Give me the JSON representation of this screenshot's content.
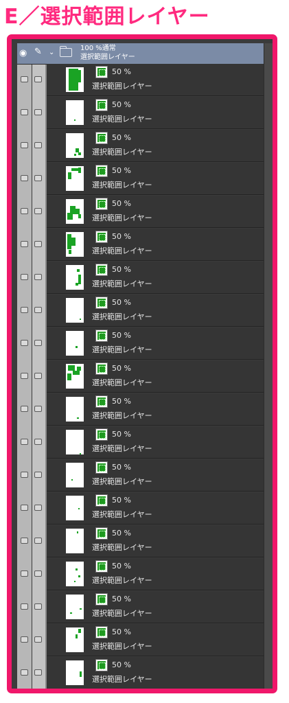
{
  "heading": "E／選択範囲レイヤー",
  "folder": {
    "opacity_blend": "100 %通常",
    "name": "選択範囲レイヤー"
  },
  "colors": {
    "frame": "#f0176a",
    "heading": "#ff2a7f",
    "folder_row": "#7b8ba6",
    "selection_green": "#1aa324"
  },
  "icons": {
    "visibility": "eye-icon",
    "edit": "pen-icon",
    "expand": "chevron-down-icon",
    "folder": "folder-icon",
    "selection": "selection-layer-icon"
  },
  "layers": [
    {
      "opacity": "50 %",
      "name": "選択範囲レイヤー"
    },
    {
      "opacity": "50 %",
      "name": "選択範囲レイヤー"
    },
    {
      "opacity": "50 %",
      "name": "選択範囲レイヤー"
    },
    {
      "opacity": "50 %",
      "name": "選択範囲レイヤー"
    },
    {
      "opacity": "50 %",
      "name": "選択範囲レイヤー"
    },
    {
      "opacity": "50 %",
      "name": "選択範囲レイヤー"
    },
    {
      "opacity": "50 %",
      "name": "選択範囲レイヤー"
    },
    {
      "opacity": "50 %",
      "name": "選択範囲レイヤー"
    },
    {
      "opacity": "50 %",
      "name": "選択範囲レイヤー"
    },
    {
      "opacity": "50 %",
      "name": "選択範囲レイヤー"
    },
    {
      "opacity": "50 %",
      "name": "選択範囲レイヤー"
    },
    {
      "opacity": "50 %",
      "name": "選択範囲レイヤー"
    },
    {
      "opacity": "50 %",
      "name": "選択範囲レイヤー"
    },
    {
      "opacity": "50 %",
      "name": "選択範囲レイヤー"
    },
    {
      "opacity": "50 %",
      "name": "選択範囲レイヤー"
    },
    {
      "opacity": "50 %",
      "name": "選択範囲レイヤー"
    },
    {
      "opacity": "50 %",
      "name": "選択範囲レイヤー"
    },
    {
      "opacity": "50 %",
      "name": "選択範囲レイヤー"
    },
    {
      "opacity": "50 %",
      "name": "選択範囲レイヤー"
    }
  ]
}
